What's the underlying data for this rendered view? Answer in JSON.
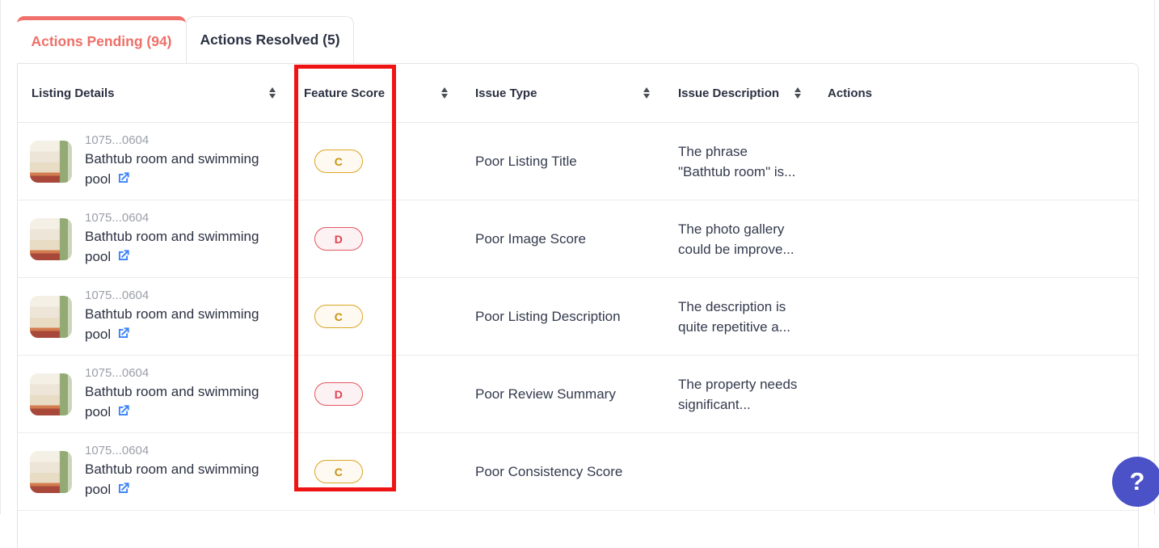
{
  "tabs": [
    {
      "label": "Actions Pending (94)",
      "active": true
    },
    {
      "label": "Actions Resolved (5)",
      "active": false
    }
  ],
  "table": {
    "columns": [
      {
        "label": "Listing Details",
        "sortable": true
      },
      {
        "label": "Feature Score",
        "sortable": true
      },
      {
        "label": "Issue Type",
        "sortable": true
      },
      {
        "label": "Issue Description",
        "sortable": true
      },
      {
        "label": "Actions",
        "sortable": false
      }
    ],
    "rows": [
      {
        "listing_id": "1075...0604",
        "listing_title": "Bathtub room and swimming\npool",
        "feature_score": "C",
        "score_level": "warning",
        "issue_type": "Poor Listing Title",
        "issue_description": "The phrase\n\"Bathtub room\" is..."
      },
      {
        "listing_id": "1075...0604",
        "listing_title": "Bathtub room and swimming\npool",
        "feature_score": "D",
        "score_level": "danger",
        "issue_type": "Poor Image Score",
        "issue_description": "The photo gallery\ncould be improve..."
      },
      {
        "listing_id": "1075...0604",
        "listing_title": "Bathtub room and swimming\npool",
        "feature_score": "C",
        "score_level": "warning",
        "issue_type": "Poor Listing Description",
        "issue_description": "The description is\nquite repetitive a..."
      },
      {
        "listing_id": "1075...0604",
        "listing_title": "Bathtub room and swimming\npool",
        "feature_score": "D",
        "score_level": "danger",
        "issue_type": "Poor Review Summary",
        "issue_description": "The property needs\nsignificant..."
      },
      {
        "listing_id": "1075...0604",
        "listing_title": "Bathtub room and swimming\npool",
        "feature_score": "C",
        "score_level": "warning",
        "issue_type": "Poor Consistency Score",
        "issue_description": ""
      }
    ]
  },
  "annotations": {
    "highlighted_column": "Feature Score",
    "highlight_color": "#ee1414"
  },
  "icons": {
    "sort": "sort-arrows-icon",
    "external_link": "external-link-icon",
    "help": "question-mark-icon",
    "thumbnail": "listing-photo-bedroom"
  },
  "help_button": {
    "glyph": "?"
  },
  "colors": {
    "active_tab": "#f0716c",
    "badge_warning": "#dca525",
    "badge_danger": "#e4565f",
    "link_blue": "#3b82f6",
    "help_button": "#4b51c6",
    "heading_text": "#2b3142"
  }
}
